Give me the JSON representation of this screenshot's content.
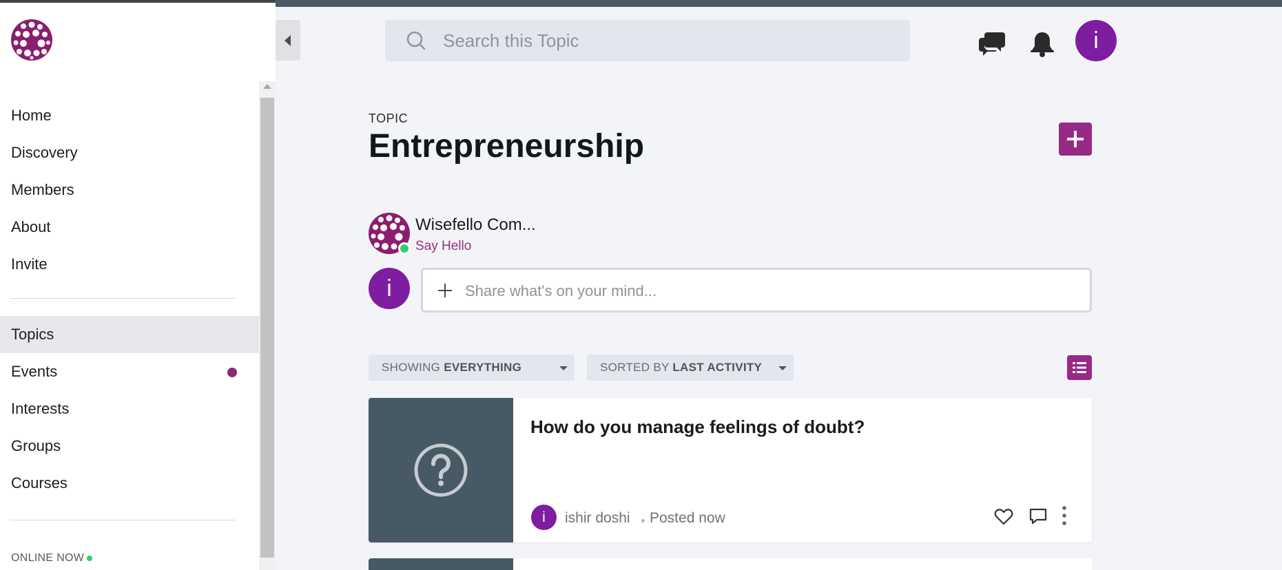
{
  "colors": {
    "brand": "#962a86",
    "avatar": "#7f1da0",
    "online": "#2fcf6a",
    "thumb": "#475964"
  },
  "sidebar": {
    "primary_items": [
      {
        "label": "Home"
      },
      {
        "label": "Discovery"
      },
      {
        "label": "Members"
      },
      {
        "label": "About"
      },
      {
        "label": "Invite"
      }
    ],
    "secondary_items": [
      {
        "label": "Topics",
        "active": true
      },
      {
        "label": "Events",
        "has_dot": true
      },
      {
        "label": "Interests"
      },
      {
        "label": "Groups"
      },
      {
        "label": "Courses"
      }
    ],
    "online_now": "ONLINE NOW"
  },
  "header": {
    "search_placeholder": "Search this Topic",
    "user_initial": "i"
  },
  "topic": {
    "label": "TOPIC",
    "title": "Entrepreneurship"
  },
  "community": {
    "name": "Wisefello Com...",
    "say_hello": "Say Hello"
  },
  "composer": {
    "user_initial": "i",
    "placeholder": "Share what's on your mind..."
  },
  "filters": {
    "showing_prefix": "SHOWING",
    "showing_value": "EVERYTHING",
    "sorted_prefix": "SORTED BY",
    "sorted_value": "LAST ACTIVITY"
  },
  "posts": [
    {
      "title": "How do you manage feelings of doubt?",
      "author_initial": "i",
      "author": "ishir doshi",
      "posted": "Posted now"
    }
  ]
}
